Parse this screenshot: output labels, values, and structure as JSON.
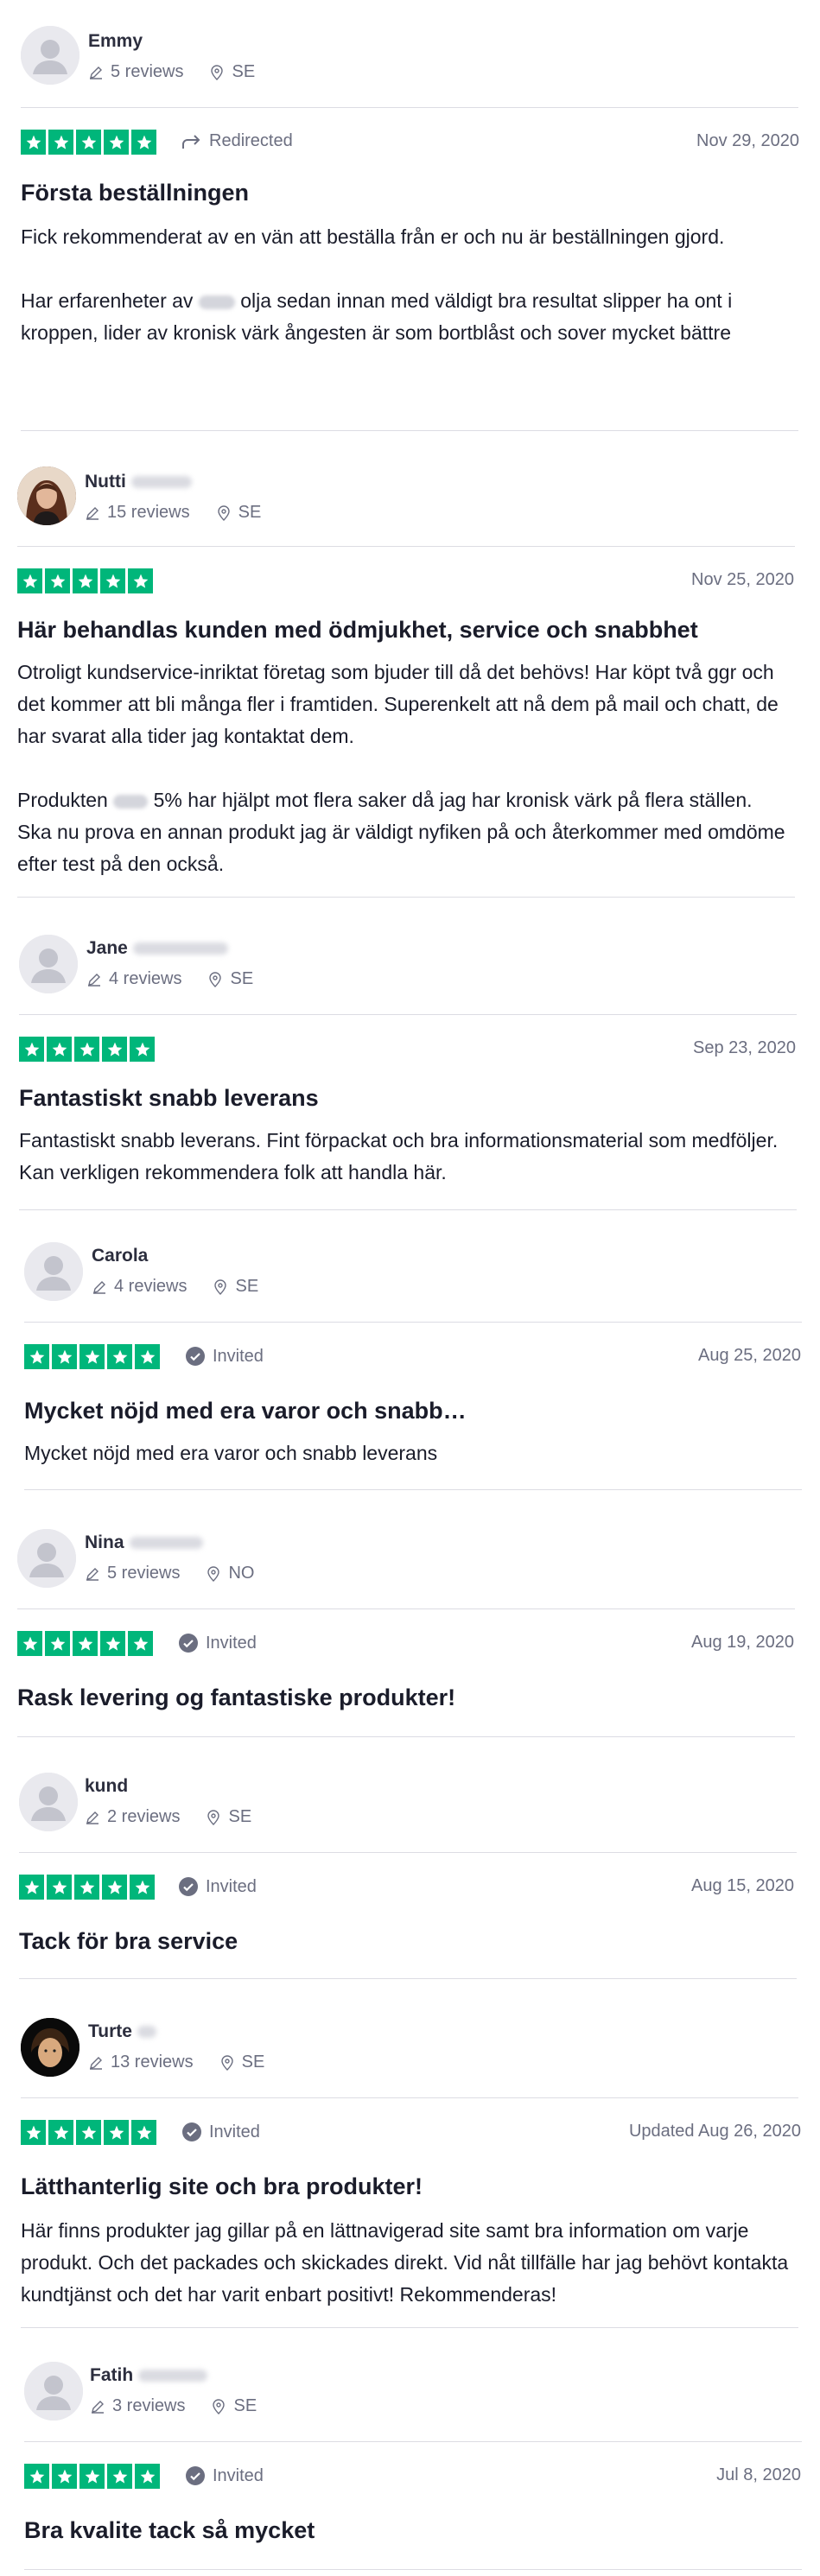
{
  "reviews": [
    {
      "name": "Emmy",
      "reviews_count": "5 reviews",
      "country": "SE",
      "tag": "Redirected",
      "date": "Nov 29, 2020",
      "rating": 5,
      "title": "Första beställningen",
      "body1": "Fick rekommenderat av en vän att beställa från er och nu är beställningen gjord.",
      "body2a": "Har erfarenheter av",
      "body2b": "olja sedan innan med väldigt bra resultat slipper ha ont i kroppen, lider av kronisk värk ångesten är som bortblåst och sover mycket bättre"
    },
    {
      "name": "Nutti",
      "reviews_count": "15 reviews",
      "country": "SE",
      "date": "Nov 25, 2020",
      "rating": 5,
      "title": "Här behandlas kunden med ödmjukhet, service och snabbhet",
      "body1": "Otroligt kundservice-inriktat företag som bjuder till då det behövs! Har köpt två ggr och det kommer att bli många fler i framtiden. Superenkelt att nå dem på mail och chatt, de har svarat alla tider jag kontaktat dem.",
      "body2a": "Produkten",
      "body2b": "5% har hjälpt mot flera saker då jag har kronisk värk på flera ställen. Ska nu prova en annan produkt jag är väldigt nyfiken på och återkommer med omdöme efter test på den också."
    },
    {
      "name": "Jane",
      "reviews_count": "4 reviews",
      "country": "SE",
      "date": "Sep 23, 2020",
      "rating": 5,
      "title": "Fantastiskt snabb leverans",
      "body1": "Fantastiskt snabb leverans. Fint förpackat och bra informationsmaterial som medföljer. Kan verkligen rekommendera folk att handla här."
    },
    {
      "name": "Carola",
      "reviews_count": "4 reviews",
      "country": "SE",
      "tag": "Invited",
      "date": "Aug 25, 2020",
      "rating": 5,
      "title": "Mycket nöjd med era varor och snabb…",
      "body1": "Mycket nöjd med era varor och snabb leverans"
    },
    {
      "name": "Nina",
      "reviews_count": "5 reviews",
      "country": "NO",
      "tag": "Invited",
      "date": "Aug 19, 2020",
      "rating": 5,
      "title": "Rask levering og fantastiske produkter!"
    },
    {
      "name": "kund",
      "reviews_count": "2 reviews",
      "country": "SE",
      "tag": "Invited",
      "date": "Aug 15, 2020",
      "rating": 5,
      "title": "Tack för bra service"
    },
    {
      "name": "Turte",
      "reviews_count": "13 reviews",
      "country": "SE",
      "tag": "Invited",
      "date": "Updated Aug 26, 2020",
      "rating": 5,
      "title": "Lätthanterlig site och bra produkter!",
      "body1": "Här finns produkter jag gillar på en lättnavigerad site samt bra information om varje produkt. Och det packades och skickades direkt. Vid nåt tillfälle har jag behövt kontakta kundtjänst och det har varit enbart positivt! Rekommenderas!"
    },
    {
      "name": "Fatih",
      "reviews_count": "3 reviews",
      "country": "SE",
      "tag": "Invited",
      "date": "Jul 8, 2020",
      "rating": 5,
      "title": "Bra kvalite tack så mycket"
    }
  ],
  "colors": {
    "star_green": "#00b67a",
    "meta_gray": "#6b6e80",
    "divider": "#dcdce3"
  }
}
